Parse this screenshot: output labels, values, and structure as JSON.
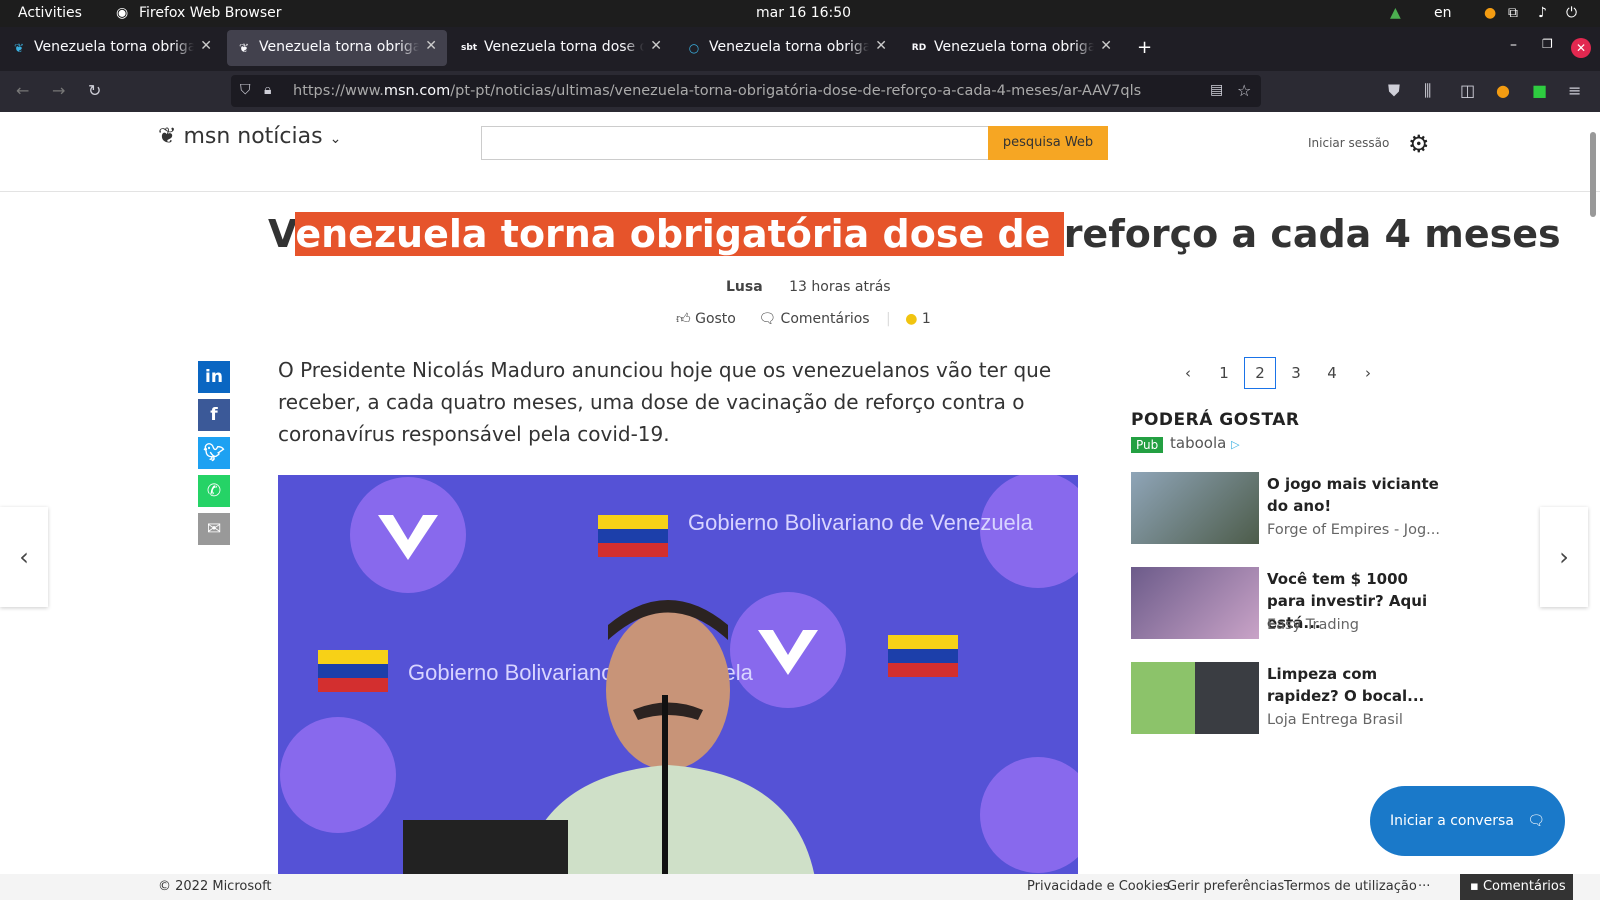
{
  "topbar": {
    "activities": "Activities",
    "app_name": "Firefox Web Browser",
    "clock": "mar 16  16:50",
    "lang": "en"
  },
  "tabs": [
    {
      "label": "Venezuela torna obrigatória",
      "favicon": "msn-icon"
    },
    {
      "label": "Venezuela torna obrigatória",
      "favicon": "msn-icon"
    },
    {
      "label": "Venezuela torna dose de reforço",
      "favicon": "sbt-icon"
    },
    {
      "label": "Venezuela torna obrigatória",
      "favicon": "circle-icon"
    },
    {
      "label": "Venezuela torna obrigatória",
      "favicon": "rd-icon"
    }
  ],
  "urlbar": {
    "url_prefix": "https://www.",
    "url_host": "msn.com",
    "url_path": "/pt-pt/noticias/ultimas/venezuela-torna-obrigatória-dose-de-reforço-a-cada-4-meses/ar-AAV7qls"
  },
  "header": {
    "logo_text": "msn notícias",
    "search_placeholder": "",
    "search_button": "pesquisa Web",
    "signin": "Iniciar sessão"
  },
  "article": {
    "headline_first": "V",
    "headline_highlight": "enezuela torna obrigatória dose de ",
    "headline_rest": "reforço a cada 4 meses",
    "author": "Lusa",
    "time": "13 horas atrás",
    "like": "Gosto",
    "comments": "Comentários",
    "reaction_count": "1",
    "body": "O Presidente Nicolás Maduro anunciou hoje que os venezuelanos vão ter que receber, a cada quatro meses, uma dose de vacinação de reforço contra o coronavírus responsável pela covid-19.",
    "photo_logo_text": "Gobierno Bolivariano de Venezuela"
  },
  "pager": {
    "pages": [
      "1",
      "2",
      "3",
      "4"
    ],
    "current": "2"
  },
  "recommendations": {
    "heading": "PODERÁ GOSTAR",
    "pub_label": "Pub",
    "provider": "taboola",
    "items": [
      {
        "title": "O jogo mais viciante do ano!",
        "source": "Forge of Empires - Jog..."
      },
      {
        "title": "Você tem $ 1000 para investir? Aqui está...",
        "source": "Easy Trading"
      },
      {
        "title": "Limpeza com rapidez? O bocal...",
        "source": "Loja Entrega Brasil"
      }
    ]
  },
  "chat_button": "Iniciar a conversa",
  "footer": {
    "copyright": "© 2022 Microsoft",
    "privacy": "Privacidade e Cookies",
    "prefs": "Gerir preferências",
    "terms": "Termos de utilização",
    "more": "···",
    "feedback": "Comentários"
  }
}
